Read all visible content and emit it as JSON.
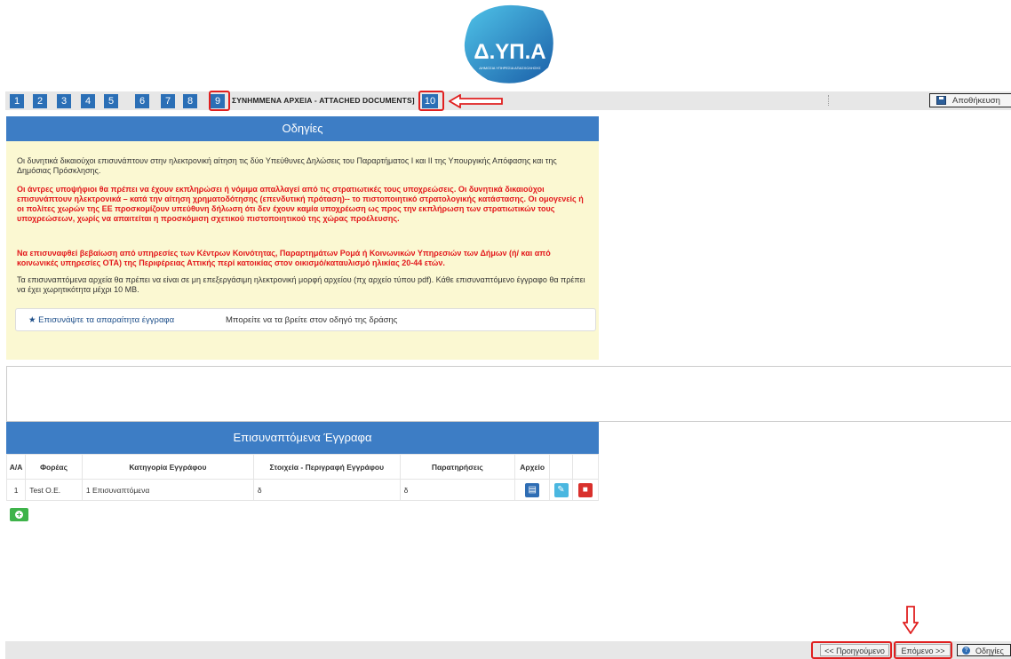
{
  "logo": {
    "text": "Δ.ΥΠ.Α",
    "subtext": "ΔΗΜΟΣΙΑ ΥΠΗΡΕΣΙΑ ΑΠΑΣΧΟΛΗΣΗΣ"
  },
  "tabs": [
    "1",
    "2",
    "3",
    "4",
    "5",
    "6",
    "7",
    "8",
    "9"
  ],
  "active_tab_label": "ΣΥΝΗΜΜΕΝΑ ΑΡΧΕΙΑ - ATTACHED DOCUMENTS]",
  "next_tab": "10",
  "save_label": "Αποθήκευση",
  "instructions": {
    "title": "Οδηγίες",
    "p1": "Οι δυνητικά δικαιούχοι επισυνάπτουν στην ηλεκτρονική αίτηση τις δύο Υπεύθυνες Δηλώσεις του Παραρτήματος Ι και ΙΙ της Υπουργικής Απόφασης και της Δημόσιας Πρόσκλησης.",
    "p2": "Οι άντρες υποψήφιοι θα πρέπει να έχουν εκπληρώσει ή νόμιμα απαλλαγεί από τις στρατιωτικές τους υποχρεώσεις. Οι δυνητικά δικαιούχοι επισυνάπτουν ηλεκτρονικά – κατά την αίτηση χρηματοδότησης (επενδυτική πρόταση)-- το πιστοποιητικό στρατολογικής κατάστασης. Οι ομογενείς ή οι πολίτες χωρών της ΕΕ προσκομίζουν υπεύθυνη δήλωση ότι δεν έχουν καμία υποχρέωση ως προς την εκπλήρωση των στρατιωτικών τους υποχρεώσεων, χωρίς να απαιτείται η προσκόμιση σχετικού πιστοποιητικού της χώρας προέλευσης.",
    "p3": "Να επισυναφθεί βεβαίωση από υπηρεσίες των Κέντρων Κοινότητας, Παραρτημάτων Ρομά ή Κοινωνικών Υπηρεσιών των Δήμων (ή/ και από κοινωνικές υπηρεσίες ΟΤΑ) της Περιφέρειας Αττικής περί κατοικίας στον οικισμό/καταυλισμό ηλικίας 20-44 ετών.",
    "p4": "Τα επισυναπτόμενα αρχεία θα πρέπει να είναι σε μη επεξεργάσιμη ηλεκτρονική μορφή αρχείου (πχ αρχείο τύπου pdf). Κάθε επισυναπτόμενο έγγραφο θα πρέπει να έχει χωρητικότητα μέχρι 10 MB.",
    "attach_link": "★ Επισυνάψτε τα απαραίτητα έγγραφα",
    "attach_note": "Μπορείτε να τα βρείτε στον οδηγό της δράσης"
  },
  "documents": {
    "title": "Επισυναπτόμενα Έγγραφα",
    "columns": [
      "Α/Α",
      "Φορέας",
      "Κατηγορία Εγγράφου",
      "Στοιχεία - Περιγραφή Εγγράφου",
      "Παρατηρήσεις",
      "Αρχείο"
    ],
    "rows": [
      {
        "aa": "1",
        "foreas": "Test O.E.",
        "category": "1 Επισυναπτόμενα",
        "desc": "δ",
        "notes": "δ"
      }
    ]
  },
  "footer": {
    "prev_label": "<< Προηγούμενο",
    "next_label": "Επόμενο >>",
    "help_label": "Οδηγίες"
  },
  "colors": {
    "primary": "#3d7dc5",
    "tab": "#2b6fb6",
    "instructions_bg": "#fbf8d2",
    "warning_text": "#e3181c",
    "annotation": "#e02020",
    "add": "#3eb34a",
    "delete": "#d9302c",
    "edit": "#4ab7e0"
  }
}
